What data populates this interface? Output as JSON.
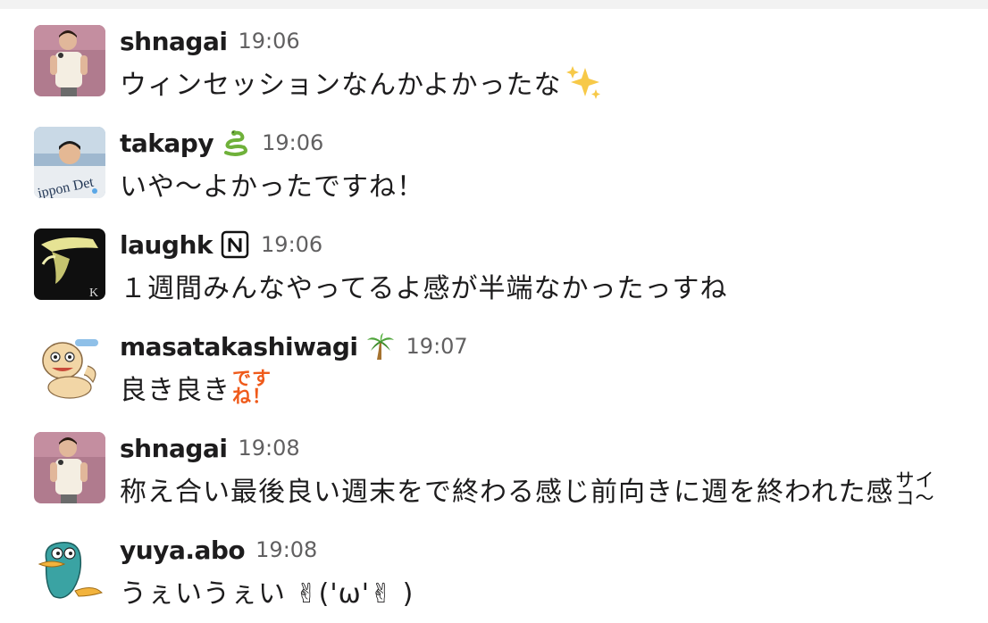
{
  "colors": {
    "name": "#1d1c1d",
    "timestamp": "#616061",
    "message_text": "#1d1c1d",
    "sticker_orange": "#ef5a1a"
  },
  "messages": [
    {
      "author": "shnagai",
      "time": "19:06",
      "text": "ウィンセッションなんかよかったな",
      "emoji": "sparkles-icon"
    },
    {
      "author": "takapy",
      "status_emoji": "snake-icon",
      "time": "19:06",
      "text": "いや〜よかったですね！"
    },
    {
      "author": "laughk",
      "status_emoji": "notion-icon",
      "time": "19:06",
      "text": "１週間みんなやってるよ感が半端なかったっすね"
    },
    {
      "author": "masatakashiwagi",
      "status_emoji": "palm-tree-icon",
      "time": "19:07",
      "text": "良き良き",
      "sticker": {
        "line1": "です",
        "line2": "ね！"
      }
    },
    {
      "author": "shnagai",
      "time": "19:08",
      "text": "称え合い最後良い週末をで終わる感じ前向きに週を終われた感",
      "sticker": {
        "line1": "サイ",
        "line2": "コ〜"
      }
    },
    {
      "author": "yuya.abo",
      "time": "19:08",
      "text": "うぇいうぇい ✌('ω'✌ )"
    }
  ]
}
